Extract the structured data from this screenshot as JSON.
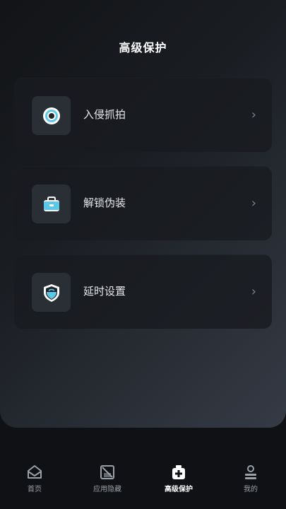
{
  "header": {
    "title": "高级保护"
  },
  "cards": [
    {
      "label": "入侵抓拍",
      "icon": "camera-lens-icon"
    },
    {
      "label": "解锁伪装",
      "icon": "briefcase-icon"
    },
    {
      "label": "延时设置",
      "icon": "shield-icon"
    }
  ],
  "chevron": "›",
  "tabs": [
    {
      "label": "首页",
      "icon": "home-icon"
    },
    {
      "label": "应用隐藏",
      "icon": "hidden-app-icon"
    },
    {
      "label": "高级保护",
      "icon": "plus-shield-icon"
    },
    {
      "label": "我的",
      "icon": "profile-icon"
    }
  ],
  "colors": {
    "accent": "#5cc7e6",
    "background": "#0f1114",
    "card": "#181b20"
  }
}
